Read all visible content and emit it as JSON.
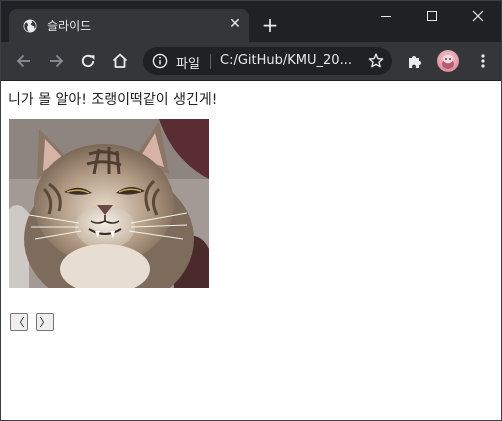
{
  "browser": {
    "tab": {
      "title": "슬라이드",
      "close_glyph": "✕"
    },
    "new_tab_glyph": "+",
    "omnibox": {
      "scheme_label": "파일",
      "url": "C:/GitHub/KMU_20..."
    },
    "icons": {
      "back": "back-arrow-icon",
      "forward": "forward-arrow-icon",
      "reload": "reload-icon",
      "home": "home-icon",
      "info": "info-icon",
      "star": "star-icon",
      "extensions": "puzzle-icon",
      "menu": "kebab-menu-icon"
    },
    "colors": {
      "tabstrip": "#202124",
      "toolbar": "#35363a",
      "omnibox": "#202124",
      "text": "#e8eaed"
    }
  },
  "page": {
    "heading": "니가 몰 알아! 조랭이떡같이 생긴게!",
    "image_subject": "grumpy tabby cat",
    "prev_label": "〈",
    "next_label": "〉"
  }
}
